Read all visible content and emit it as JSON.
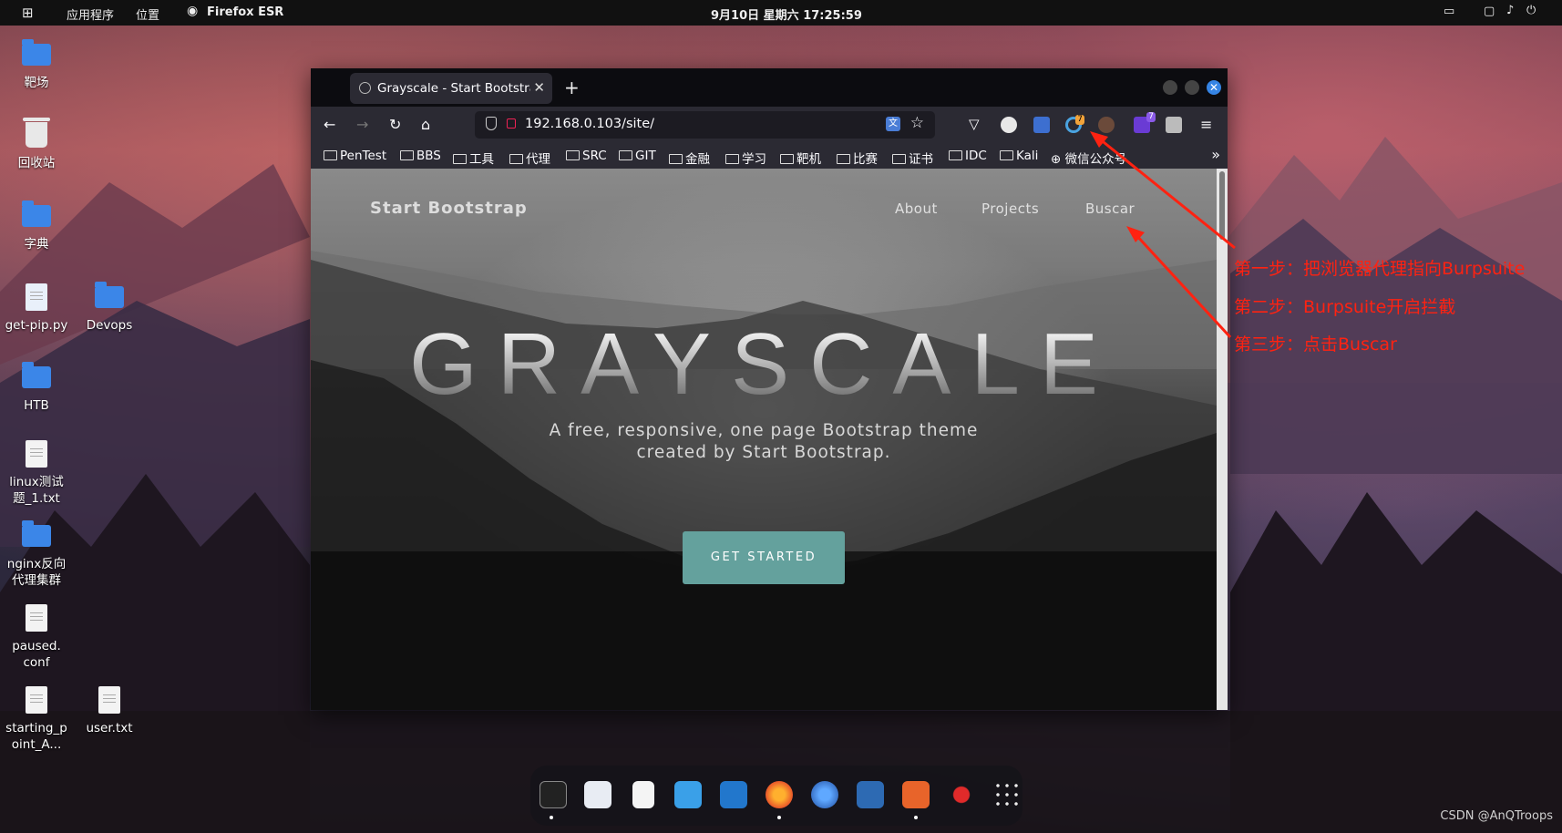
{
  "topbar": {
    "apps_menu": "应用程序",
    "places_menu": "位置",
    "active_app": "Firefox ESR",
    "datetime": "9月10日 星期六 17:25:59"
  },
  "desktop_icons": [
    "靶场",
    "回收站",
    "字典",
    "get-pip.py",
    "Devops",
    "HTB",
    "linux测试题_1.txt",
    "nginx反向代理集群",
    "paused.conf",
    "starting_point_A...",
    "user.txt"
  ],
  "browser": {
    "tab_title": "Grayscale - Start Bootstrap",
    "new_tab": "+",
    "url": "192.168.0.103/site/",
    "extension_badge_1": "7",
    "extension_badge_2": "7",
    "bookmarks": [
      "PenTest",
      "BBS",
      "工具",
      "代理",
      "SRC",
      "GIT",
      "金融",
      "学习",
      "靶机",
      "比赛",
      "证书",
      "IDC",
      "Kali",
      "微信公众号"
    ]
  },
  "page": {
    "brand": "Start Bootstrap",
    "nav": [
      "About",
      "Projects",
      "Buscar"
    ],
    "hero_title": "GRAYSCALE",
    "subtitle_line1": "A free, responsive, one page Bootstrap theme",
    "subtitle_line2": "created by Start Bootstrap.",
    "cta": "GET STARTED"
  },
  "annotations": [
    "第一步：把浏览器代理指向Burpsuite",
    "第二步：Burpsuite开启拦截",
    "第三步：点击Buscar"
  ],
  "annotation_color": "#ff2211",
  "dock_apps": [
    "terminal",
    "files",
    "text-editor",
    "network",
    "vscode",
    "firefox",
    "chromium",
    "metasploit",
    "burpsuite",
    "cherrytree",
    "app-grid"
  ],
  "watermark": "CSDN @AnQTroops"
}
